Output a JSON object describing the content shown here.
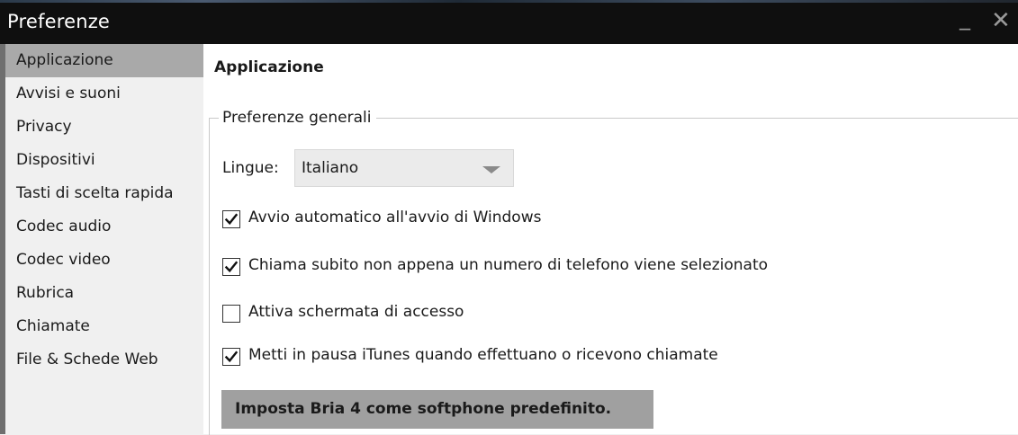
{
  "window": {
    "title": "Preferenze",
    "minimize_glyph": "_",
    "close_glyph": "✕"
  },
  "sidebar": {
    "items": [
      {
        "label": "Applicazione",
        "selected": true
      },
      {
        "label": "Avvisi e suoni",
        "selected": false
      },
      {
        "label": "Privacy",
        "selected": false
      },
      {
        "label": "Dispositivi",
        "selected": false
      },
      {
        "label": "Tasti di scelta rapida",
        "selected": false
      },
      {
        "label": "Codec audio",
        "selected": false
      },
      {
        "label": "Codec video",
        "selected": false
      },
      {
        "label": "Rubrica",
        "selected": false
      },
      {
        "label": "Chiamate",
        "selected": false
      },
      {
        "label": "File & Schede Web",
        "selected": false
      }
    ]
  },
  "main": {
    "page_title": "Applicazione",
    "group_title": "Preferenze generali",
    "language": {
      "label": "Lingue:",
      "value": "Italiano"
    },
    "options": [
      {
        "label": "Avvio automatico all'avvio di Windows",
        "checked": true
      },
      {
        "label": "Chiama subito non appena un numero di telefono viene selezionato",
        "checked": true
      },
      {
        "label": "Attiva schermata di accesso",
        "checked": false
      },
      {
        "label": "Metti in pausa iTunes quando effettuano o ricevono chiamate",
        "checked": true
      }
    ],
    "default_button_label": "Imposta Bria 4 come softphone predefinito."
  },
  "colors": {
    "titlebar": "#0f0f0f",
    "sidebar_selected": "#a9a9a9",
    "button_bg": "#a0a0a0"
  }
}
